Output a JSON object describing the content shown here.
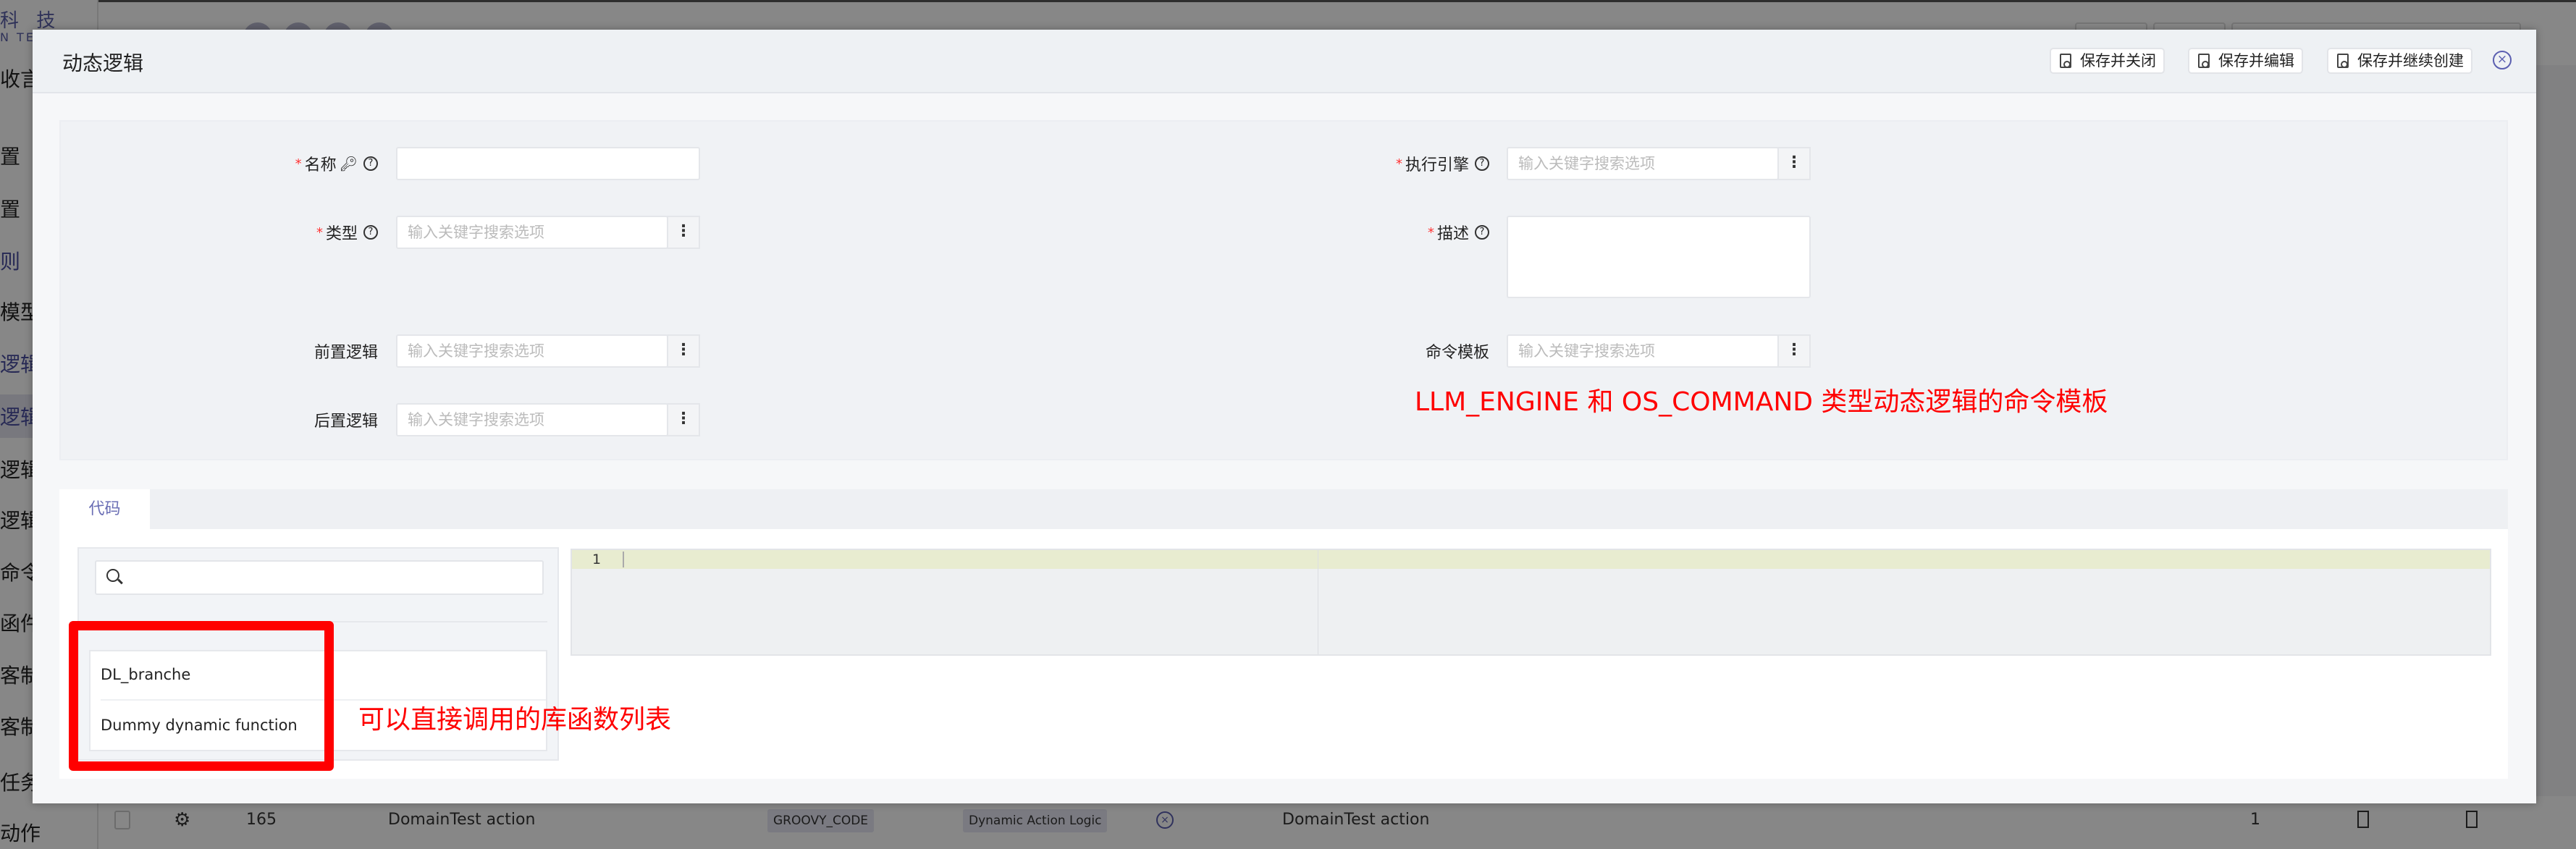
{
  "background": {
    "logo": "科 技",
    "logo_sub": "N TECH",
    "sidebar_items": [
      "收言利",
      "置",
      "置",
      "则",
      "模型",
      "逻辑",
      "逻辑",
      "逻辑引",
      "逻辑类",
      "命令模",
      "函件",
      "客制化",
      "客制化",
      "任务",
      "动作"
    ],
    "active_index": 6,
    "row": {
      "id": "165",
      "name": "DomainTest action",
      "type_badge": "GROOVY_CODE",
      "category_badge": "Dynamic Action Logic",
      "display_name": "DomainTest action",
      "count": "1"
    }
  },
  "modal": {
    "title": "动态逻辑",
    "buttons": {
      "save_close": "保存并关闭",
      "save_edit": "保存并编辑",
      "save_continue": "保存并继续创建"
    },
    "form": {
      "name_label": "名称",
      "name_value": "",
      "type_label": "类型",
      "pre_logic_label": "前置逻辑",
      "post_logic_label": "后置逻辑",
      "engine_label": "执行引擎",
      "desc_label": "描述",
      "desc_value": "",
      "cmd_template_label": "命令模板",
      "placeholder": "输入关键字搜索选项"
    },
    "tabs": [
      {
        "label": "代码",
        "active": true
      }
    ],
    "library": {
      "search_value": "",
      "items": [
        "DL_branche",
        "Dummy dynamic function"
      ]
    },
    "editor": {
      "line_numbers": [
        "1"
      ],
      "content": ""
    }
  },
  "annotations": {
    "cmd_template_note": "LLM_ENGINE 和 OS_COMMAND 类型动态逻辑的命令模板",
    "library_note": "可以直接调用的库函数列表",
    "color": "#ff0000"
  },
  "colors": {
    "accent": "#5b5fb0",
    "required": "#ff3333"
  }
}
